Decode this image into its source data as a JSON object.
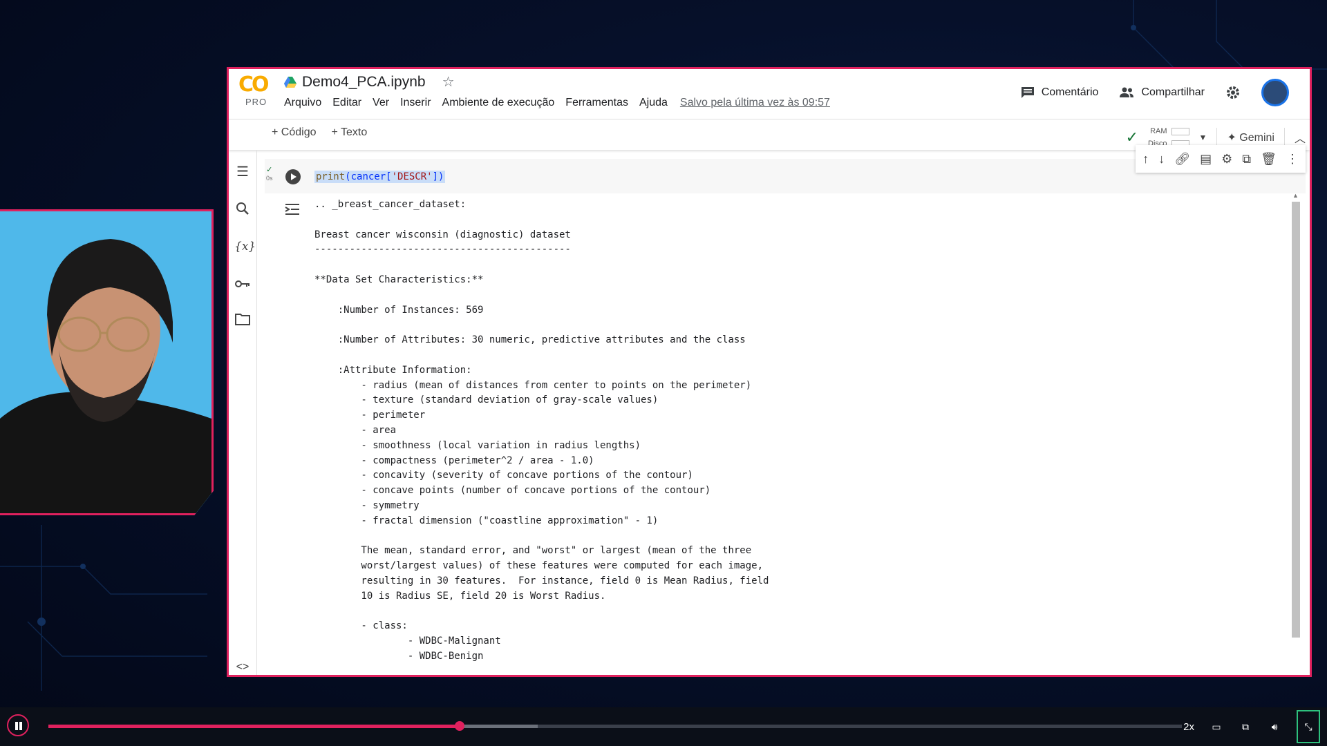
{
  "app": {
    "logo_text": "CO",
    "logo_badge": "PRO",
    "notebook_title": "Demo4_PCA.ipynb",
    "menu": [
      "Arquivo",
      "Editar",
      "Ver",
      "Inserir",
      "Ambiente de execução",
      "Ferramentas",
      "Ajuda"
    ],
    "saved_status": "Salvo pela última vez às 09:57",
    "comment_label": "Comentário",
    "share_label": "Compartilhar"
  },
  "toolbar": {
    "add_code": "+ Código",
    "add_text": "+ Texto",
    "ram_label": "RAM",
    "disk_label": "Disco",
    "gemini_label": "Gemini"
  },
  "cell": {
    "exec_time": "0s",
    "code_fn": "print",
    "code_open": "(cancer[",
    "code_str": "'DESCR'",
    "code_close": "])",
    "output": ".. _breast_cancer_dataset:\n\nBreast cancer wisconsin (diagnostic) dataset\n--------------------------------------------\n\n**Data Set Characteristics:**\n\n    :Number of Instances: 569\n\n    :Number of Attributes: 30 numeric, predictive attributes and the class\n\n    :Attribute Information:\n        - radius (mean of distances from center to points on the perimeter)\n        - texture (standard deviation of gray-scale values)\n        - perimeter\n        - area\n        - smoothness (local variation in radius lengths)\n        - compactness (perimeter^2 / area - 1.0)\n        - concavity (severity of concave portions of the contour)\n        - concave points (number of concave portions of the contour)\n        - symmetry\n        - fractal dimension (\"coastline approximation\" - 1)\n\n        The mean, standard error, and \"worst\" or largest (mean of the three\n        worst/largest values) of these features were computed for each image,\n        resulting in 30 features.  For instance, field 0 is Mean Radius, field\n        10 is Radius SE, field 20 is Worst Radius.\n\n        - class:\n                - WDBC-Malignant\n                - WDBC-Benign"
  },
  "player": {
    "speed": "2x",
    "progress_fraction": 0.363,
    "buffered_fraction": 0.432,
    "accent": "#e0215e"
  },
  "colors": {
    "frame_accent": "#e0215e",
    "cam_background": "#4fb8ea",
    "page_background": "#06102a"
  }
}
